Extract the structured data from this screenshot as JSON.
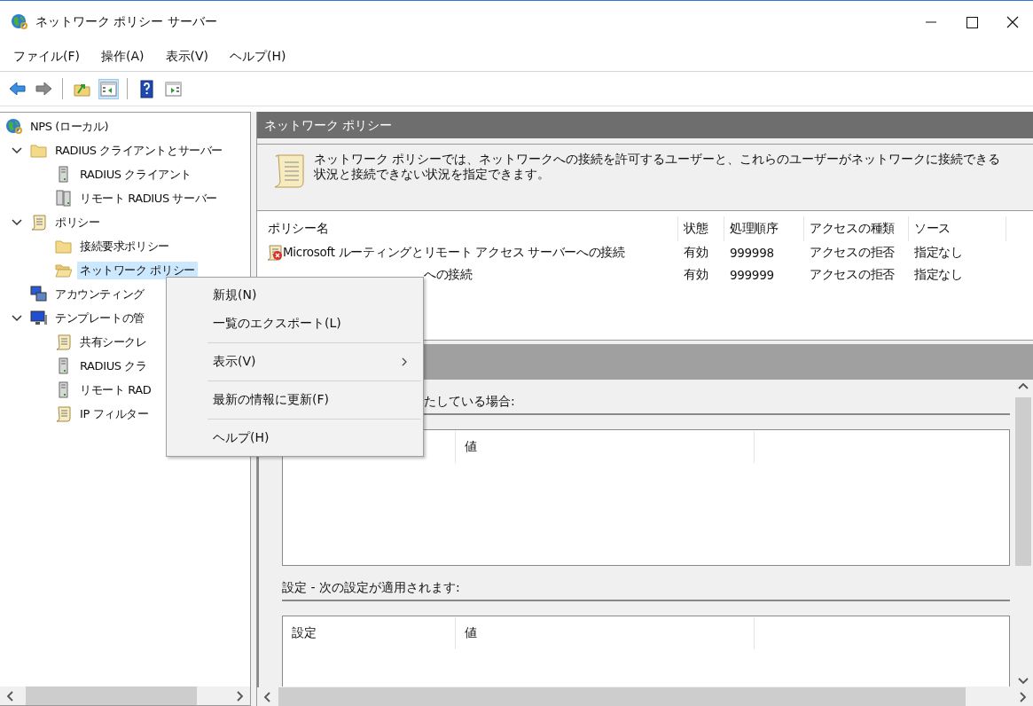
{
  "window": {
    "title": "ネットワーク ポリシー サーバー"
  },
  "menu_bar": [
    "ファイル(F)",
    "操作(A)",
    "表示(V)",
    "ヘルプ(H)"
  ],
  "toolbar": [
    [
      {
        "kind": "back",
        "selected": false
      },
      {
        "kind": "forward",
        "selected": false
      }
    ],
    [
      {
        "kind": "up",
        "selected": false
      },
      {
        "kind": "tree",
        "selected": true
      }
    ],
    [
      {
        "kind": "help",
        "selected": false
      },
      {
        "kind": "actions",
        "selected": false
      }
    ]
  ],
  "tree": [
    {
      "label": "NPS (ローカル)",
      "kind": "globe",
      "selected": false,
      "children": [
        {
          "label": "RADIUS クライアントとサーバー",
          "kind": "folder",
          "selected": false,
          "expanded": true,
          "children": [
            {
              "label": "RADIUS クライアント",
              "kind": "server",
              "selected": false
            },
            {
              "label": "リモート RADIUS サーバー",
              "kind": "servers",
              "selected": false
            }
          ]
        },
        {
          "label": "ポリシー",
          "kind": "scroll",
          "selected": false,
          "expanded": true,
          "children": [
            {
              "label": "接続要求ポリシー",
              "kind": "folder",
              "selected": false
            },
            {
              "label": "ネットワーク ポリシー",
              "kind": "folder-open",
              "selected": true
            }
          ]
        },
        {
          "label": "アカウンティング",
          "kind": "monitors",
          "selected": false
        },
        {
          "label": "テンプレートの管",
          "kind": "monitor",
          "selected": false,
          "expanded": true,
          "children": [
            {
              "label": "共有シークレ",
              "kind": "scroll",
              "selected": false
            },
            {
              "label": "RADIUS クラ",
              "kind": "server",
              "selected": false
            },
            {
              "label": "リモート RAD",
              "kind": "server",
              "selected": false
            },
            {
              "label": "IP フィルター",
              "kind": "scroll",
              "selected": false
            }
          ]
        }
      ]
    }
  ],
  "content": {
    "title": "ネットワーク ポリシー",
    "description": "ネットワーク ポリシーでは、ネットワークへの接続を許可するユーザーと、これらのユーザーがネットワークに接続できる状況と接続できない状況を指定できます。",
    "columns": [
      "ポリシー名",
      "状態",
      "処理順序",
      "アクセスの種類",
      "ソース"
    ],
    "rows": [
      {
        "name": "Microsoft ルーティングとリモート アクセス サーバーへの接続",
        "name_covered": false,
        "status": "有効",
        "order": "999998",
        "access": "アクセスの拒否",
        "source": "指定なし"
      },
      {
        "name": "への接続",
        "name_covered": true,
        "status": "有効",
        "order": "999999",
        "access": "アクセスの拒否",
        "source": "指定なし"
      }
    ],
    "sections": [
      {
        "title": "たしている場合:",
        "title_covered": true,
        "columns": [
          "値"
        ],
        "first_column_covered": true
      },
      {
        "title": "設定 - 次の設定が適用されます:",
        "title_covered": false,
        "columns": [
          "設定",
          "値"
        ],
        "first_column_covered": false
      }
    ]
  },
  "context_menu": [
    [
      {
        "label": "新規(N)",
        "submenu": false
      },
      {
        "label": "一覧のエクスポート(L)",
        "submenu": false
      }
    ],
    [
      {
        "label": "表示(V)",
        "submenu": true
      }
    ],
    [
      {
        "label": "最新の情報に更新(F)",
        "submenu": false
      }
    ],
    [
      {
        "label": "ヘルプ(H)",
        "submenu": false
      }
    ]
  ]
}
